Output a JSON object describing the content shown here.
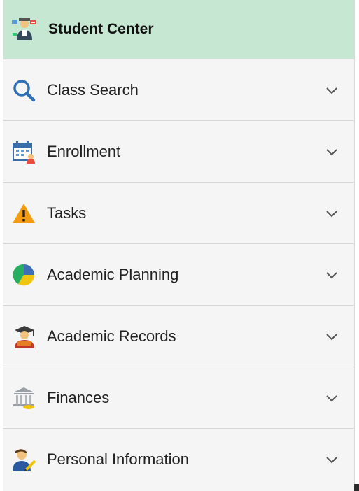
{
  "header": {
    "title": "Student Center",
    "icon": "student-center-icon"
  },
  "menu": {
    "items": [
      {
        "label": "Class Search",
        "icon": "search-icon"
      },
      {
        "label": "Enrollment",
        "icon": "calendar-icon"
      },
      {
        "label": "Tasks",
        "icon": "warning-icon"
      },
      {
        "label": "Academic Planning",
        "icon": "pie-chart-icon"
      },
      {
        "label": "Academic Records",
        "icon": "graduate-icon"
      },
      {
        "label": "Finances",
        "icon": "bank-icon"
      },
      {
        "label": "Personal Information",
        "icon": "person-edit-icon"
      }
    ]
  },
  "colors": {
    "header_bg": "#c6e8d3",
    "item_bg": "#f5f5f5",
    "search_blue": "#2f6fb5",
    "warning_orange": "#f39c12"
  }
}
